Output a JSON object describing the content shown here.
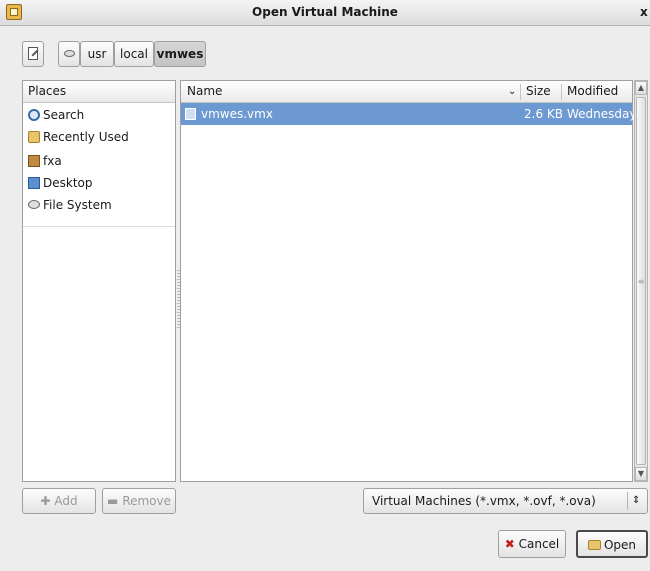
{
  "window": {
    "title": "Open Virtual Machine",
    "close_label": "x"
  },
  "pathbar": {
    "segments": [
      "usr",
      "local",
      "vmwes"
    ]
  },
  "places": {
    "header": "Places",
    "items": [
      {
        "label": "Search",
        "icon": "search-icon"
      },
      {
        "label": "Recently Used",
        "icon": "folder-icon"
      },
      {
        "label": "fxa",
        "icon": "home-icon"
      },
      {
        "label": "Desktop",
        "icon": "desktop-icon"
      },
      {
        "label": "File System",
        "icon": "drive-icon"
      }
    ],
    "add_label": "Add",
    "remove_label": "Remove"
  },
  "files": {
    "columns": {
      "name": "Name",
      "size": "Size",
      "modified": "Modified"
    },
    "rows": [
      {
        "name": "vmwes.vmx",
        "size": "2.6 KB",
        "modified": "Wednesday",
        "selected": true
      }
    ]
  },
  "filter": {
    "value": "Virtual Machines (*.vmx, *.ovf, *.ova)"
  },
  "actions": {
    "cancel_label": "Cancel",
    "open_label": "Open"
  },
  "colors": {
    "selection": "#6d99d2",
    "window_bg": "#ededed"
  }
}
